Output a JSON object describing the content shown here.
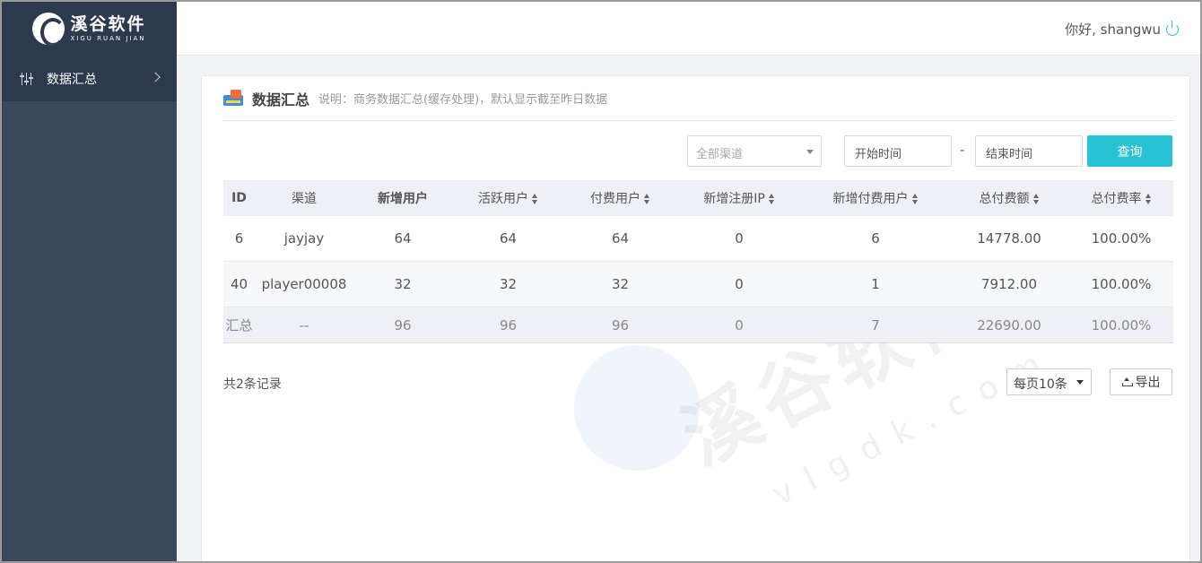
{
  "brand": {
    "name_cn": "溪谷软件",
    "name_en": "XIGU RUAN JIAN"
  },
  "sidebar": {
    "items": [
      {
        "label": "数据汇总",
        "icon": "sliders-icon"
      }
    ]
  },
  "header": {
    "greeting": "你好, shangwu",
    "power_icon": "power-icon"
  },
  "panel": {
    "title": "数据汇总",
    "description": "说明：商务数据汇总(缓存处理)，默认显示截至昨日数据"
  },
  "filters": {
    "channel_placeholder": "全部渠道",
    "start_placeholder": "开始时间",
    "separator": "-",
    "end_placeholder": "结束时间",
    "query_label": "查询"
  },
  "table": {
    "columns": [
      "ID",
      "渠道",
      "新增用户",
      "活跃用户",
      "付费用户",
      "新增注册IP",
      "新增付费用户",
      "总付费额",
      "总付费率"
    ],
    "rows": [
      [
        "6",
        "jayjay",
        "64",
        "64",
        "64",
        "0",
        "6",
        "14778.00",
        "100.00%"
      ],
      [
        "40",
        "player00008",
        "32",
        "32",
        "32",
        "0",
        "1",
        "7912.00",
        "100.00%"
      ]
    ],
    "summary": [
      "汇总",
      "--",
      "96",
      "96",
      "96",
      "0",
      "7",
      "22690.00",
      "100.00%"
    ]
  },
  "footer": {
    "record_count": "共2条记录",
    "page_size": "每页10条",
    "export_label": "导出"
  },
  "watermark": {
    "text": "溪谷软件",
    "sub": "vlgdk.com"
  },
  "colors": {
    "accent": "#29c2d4",
    "sidebar": "#3a475c",
    "sidebar_dark": "#2d3a4e"
  }
}
